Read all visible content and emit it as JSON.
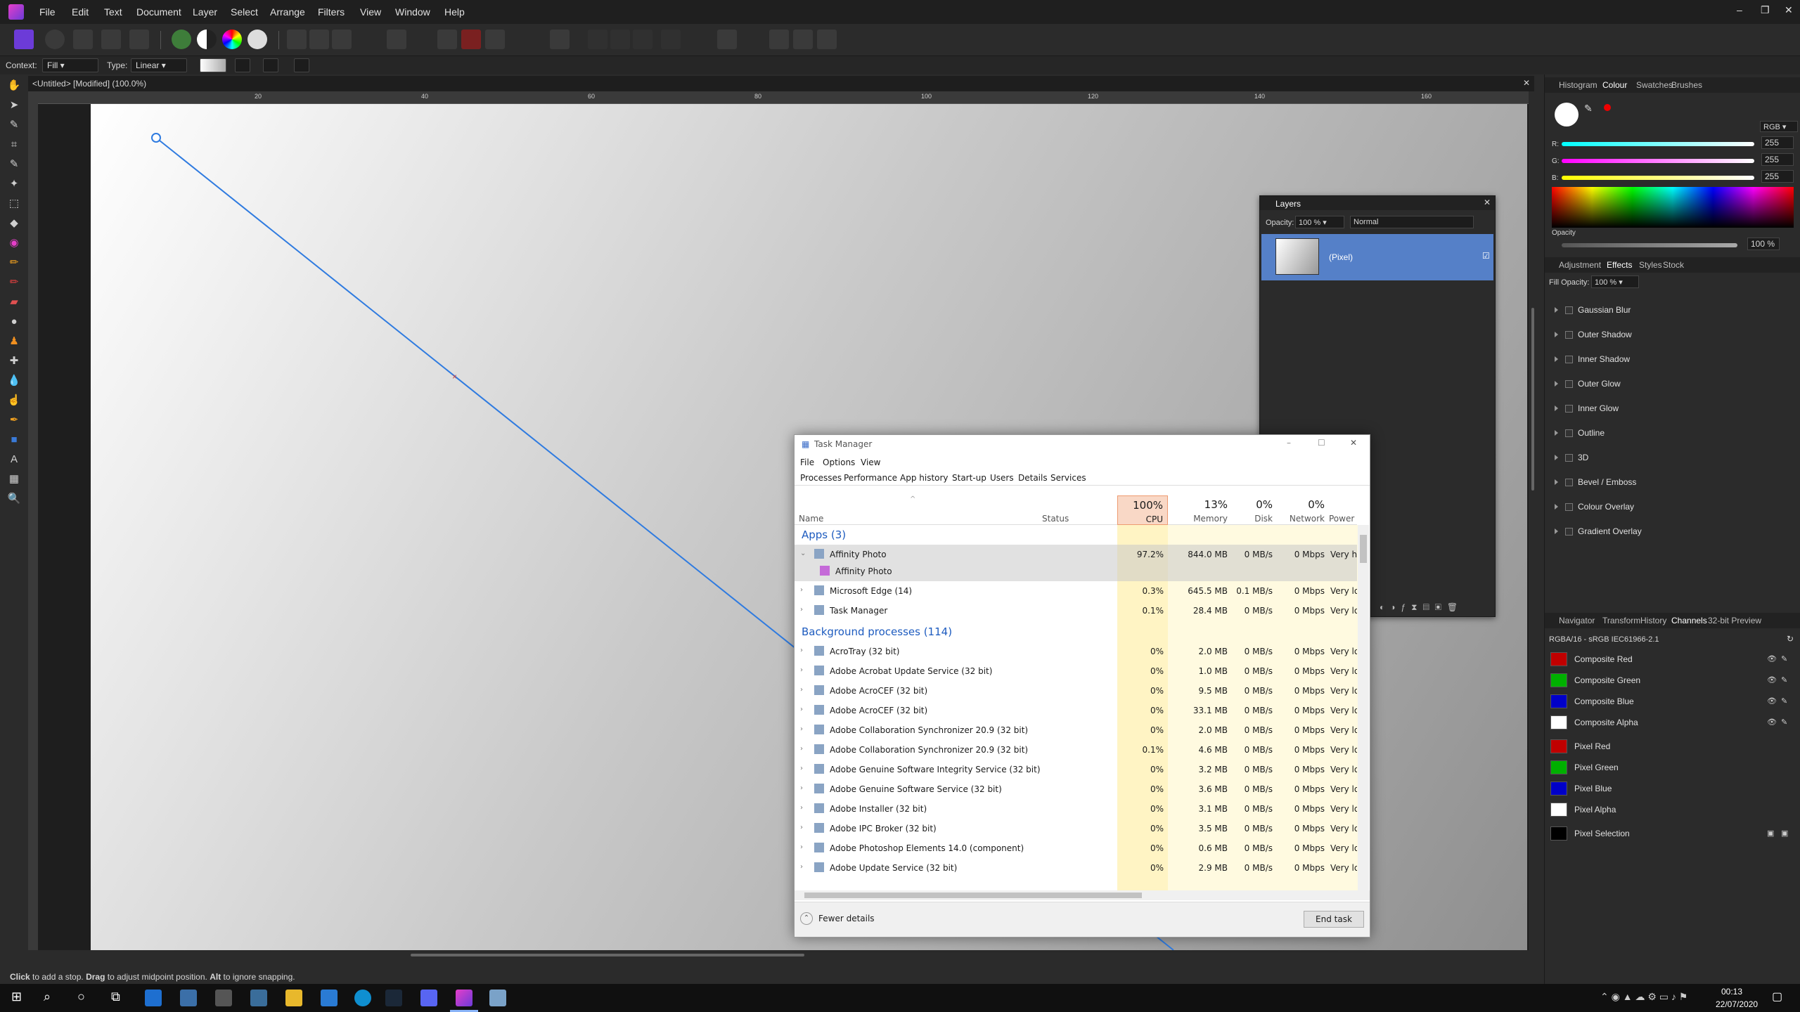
{
  "menubar": {
    "items": [
      "File",
      "Edit",
      "Text",
      "Document",
      "Layer",
      "Select",
      "Arrange",
      "Filters",
      "View",
      "Window",
      "Help"
    ]
  },
  "context": {
    "label": "Context:",
    "context_value": "Fill",
    "type_label": "Type:",
    "type_value": "Linear"
  },
  "document": {
    "tab_title": "<Untitled> [Modified] (100.0%)",
    "ruler_marks": [
      "20",
      "40",
      "60",
      "80",
      "100",
      "120",
      "140",
      "160"
    ]
  },
  "status": {
    "click": "Click",
    "t1": " to add a stop. ",
    "drag": "Drag",
    "t2": " to adjust midpoint position. ",
    "alt": "Alt",
    "t3": " to ignore snapping."
  },
  "colour_panel": {
    "tabs": [
      "Histogram",
      "Colour",
      "Swatches",
      "Brushes"
    ],
    "model": "RGB",
    "r_label": "R:",
    "g_label": "G:",
    "b_label": "B:",
    "r": "255",
    "g": "255",
    "b": "255",
    "opacity_label": "Opacity",
    "opacity": "100 %"
  },
  "effects_panel": {
    "tabs": [
      "Adjustment",
      "Effects",
      "Styles",
      "Stock"
    ],
    "fill_opacity_label": "Fill Opacity:",
    "fill_opacity": "100 %",
    "effects": [
      "Gaussian Blur",
      "Outer Shadow",
      "Inner Shadow",
      "Outer Glow",
      "Inner Glow",
      "Outline",
      "3D",
      "Bevel / Emboss",
      "Colour Overlay",
      "Gradient Overlay"
    ]
  },
  "channels_panel": {
    "tabs": [
      "Navigator",
      "Transform",
      "History",
      "Channels",
      "32-bit Preview"
    ],
    "profile": "RGBA/16 - sRGB IEC61966-2.1",
    "composite": [
      {
        "name": "Composite Red",
        "color": "#c00000"
      },
      {
        "name": "Composite Green",
        "color": "#00b000"
      },
      {
        "name": "Composite Blue",
        "color": "#0000c8"
      },
      {
        "name": "Composite Alpha",
        "color": "#ffffff"
      }
    ],
    "pixel": [
      {
        "name": "Pixel Red",
        "color": "#c00000"
      },
      {
        "name": "Pixel Green",
        "color": "#00b000"
      },
      {
        "name": "Pixel Blue",
        "color": "#0000c8"
      },
      {
        "name": "Pixel Alpha",
        "color": "#ffffff"
      }
    ],
    "selection": {
      "name": "Pixel Selection",
      "color": "#000000"
    }
  },
  "layers_panel": {
    "title": "Layers",
    "opacity_label": "Opacity:",
    "opacity": "100 %",
    "blend": "Normal",
    "layer_name": "(Pixel)"
  },
  "task_manager": {
    "title": "Task Manager",
    "menu": [
      "File",
      "Options",
      "View"
    ],
    "tabs": [
      "Processes",
      "Performance",
      "App history",
      "Start-up",
      "Users",
      "Details",
      "Services"
    ],
    "headers": {
      "name": "Name",
      "status": "Status",
      "cpu_pct": "100%",
      "cpu": "CPU",
      "mem_pct": "13%",
      "mem": "Memory",
      "disk_pct": "0%",
      "disk": "Disk",
      "net_pct": "0%",
      "net": "Network",
      "power": "Power usag"
    },
    "apps_group": "Apps (3)",
    "bg_group": "Background processes (114)",
    "apps": [
      {
        "name": "Affinity Photo",
        "cpu": "97.2%",
        "mem": "844.0 MB",
        "disk": "0 MB/s",
        "net": "0 Mbps",
        "power": "Very high"
      },
      {
        "name": "Affinity Photo",
        "child": true
      },
      {
        "name": "Microsoft Edge (14)",
        "cpu": "0.3%",
        "mem": "645.5 MB",
        "disk": "0.1 MB/s",
        "net": "0 Mbps",
        "power": "Very low"
      },
      {
        "name": "Task Manager",
        "cpu": "0.1%",
        "mem": "28.4 MB",
        "disk": "0 MB/s",
        "net": "0 Mbps",
        "power": "Very low"
      }
    ],
    "bg": [
      {
        "name": "AcroTray (32 bit)",
        "cpu": "0%",
        "mem": "2.0 MB",
        "disk": "0 MB/s",
        "net": "0 Mbps",
        "power": "Very low"
      },
      {
        "name": "Adobe Acrobat Update Service (32 bit)",
        "cpu": "0%",
        "mem": "1.0 MB",
        "disk": "0 MB/s",
        "net": "0 Mbps",
        "power": "Very low"
      },
      {
        "name": "Adobe AcroCEF (32 bit)",
        "cpu": "0%",
        "mem": "9.5 MB",
        "disk": "0 MB/s",
        "net": "0 Mbps",
        "power": "Very low"
      },
      {
        "name": "Adobe AcroCEF (32 bit)",
        "cpu": "0%",
        "mem": "33.1 MB",
        "disk": "0 MB/s",
        "net": "0 Mbps",
        "power": "Very low"
      },
      {
        "name": "Adobe Collaboration Synchronizer 20.9 (32 bit)",
        "cpu": "0%",
        "mem": "2.0 MB",
        "disk": "0 MB/s",
        "net": "0 Mbps",
        "power": "Very low"
      },
      {
        "name": "Adobe Collaboration Synchronizer 20.9 (32 bit)",
        "cpu": "0.1%",
        "mem": "4.6 MB",
        "disk": "0 MB/s",
        "net": "0 Mbps",
        "power": "Very low"
      },
      {
        "name": "Adobe Genuine Software Integrity Service (32 bit)",
        "cpu": "0%",
        "mem": "3.2 MB",
        "disk": "0 MB/s",
        "net": "0 Mbps",
        "power": "Very low"
      },
      {
        "name": "Adobe Genuine Software Service (32 bit)",
        "cpu": "0%",
        "mem": "3.6 MB",
        "disk": "0 MB/s",
        "net": "0 Mbps",
        "power": "Very low"
      },
      {
        "name": "Adobe Installer (32 bit)",
        "cpu": "0%",
        "mem": "3.1 MB",
        "disk": "0 MB/s",
        "net": "0 Mbps",
        "power": "Very low"
      },
      {
        "name": "Adobe IPC Broker (32 bit)",
        "cpu": "0%",
        "mem": "3.5 MB",
        "disk": "0 MB/s",
        "net": "0 Mbps",
        "power": "Very low"
      },
      {
        "name": "Adobe Photoshop Elements 14.0 (component)",
        "cpu": "0%",
        "mem": "0.6 MB",
        "disk": "0 MB/s",
        "net": "0 Mbps",
        "power": "Very low"
      },
      {
        "name": "Adobe Update Service (32 bit)",
        "cpu": "0%",
        "mem": "2.9 MB",
        "disk": "0 MB/s",
        "net": "0 Mbps",
        "power": "Very low"
      }
    ],
    "fewer_details": "Fewer details",
    "end_task": "End task"
  },
  "taskbar": {
    "time": "00:13",
    "date": "22/07/2020"
  }
}
